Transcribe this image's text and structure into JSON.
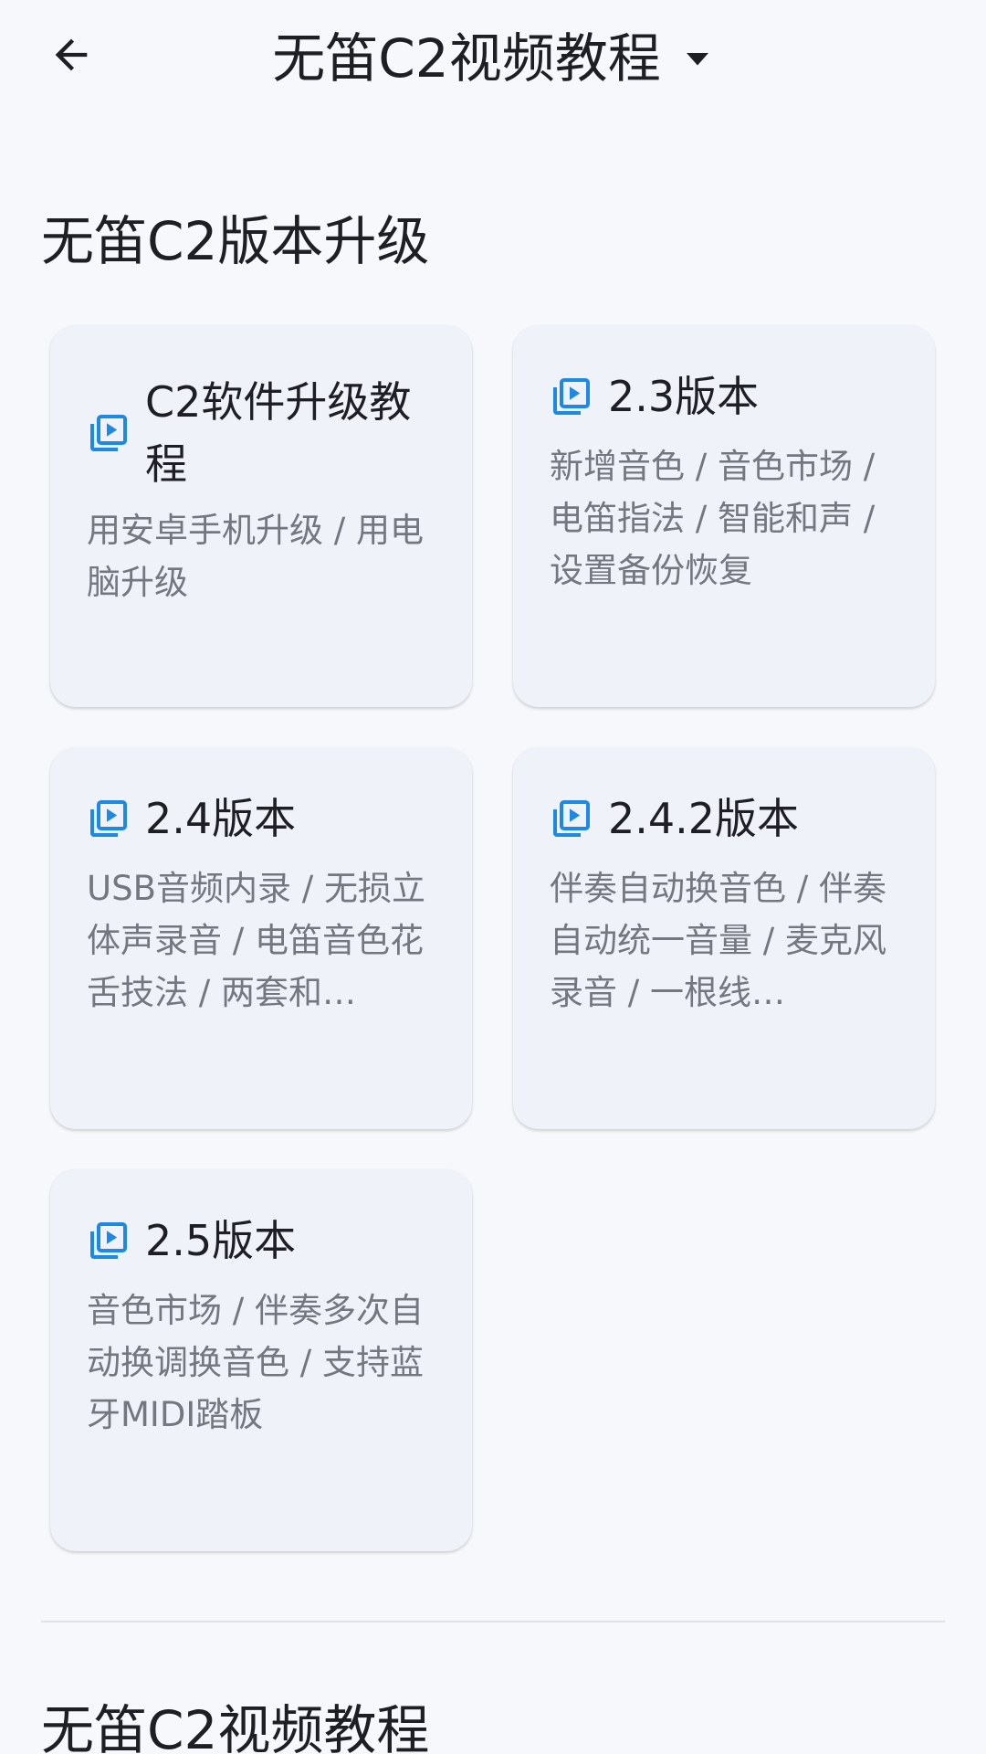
{
  "app_bar": {
    "back_icon": "arrow-back-icon",
    "title": "无笛C2视频教程",
    "dropdown_icon": "arrow-drop-down-icon"
  },
  "sections": [
    {
      "title": "无笛C2版本升级",
      "cards": [
        {
          "icon": "video-library-icon",
          "title": "C2软件升级教程",
          "description": "用安卓手机升级 / 用电脑升级"
        },
        {
          "icon": "video-library-icon",
          "title": "2.3版本",
          "description": "新增音色 / 音色市场 / 电笛指法 / 智能和声 / 设置备份恢复"
        },
        {
          "icon": "video-library-icon",
          "title": "2.4版本",
          "description": "USB音频内录 / 无损立体声录音 / 电笛音色花舌技法 / 两套和…"
        },
        {
          "icon": "video-library-icon",
          "title": "2.4.2版本",
          "description": "伴奏自动换音色 / 伴奏自动统一音量 / 麦克风录音 / 一根线…"
        },
        {
          "icon": "video-library-icon",
          "title": "2.5版本",
          "description": "音色市场 / 伴奏多次自动换调换音色 / 支持蓝牙MIDI踏板"
        }
      ]
    },
    {
      "title": "无笛C2视频教程"
    }
  ],
  "colors": {
    "background": "#f6f8fc",
    "card": "#f0f2fa",
    "accent_icon": "#1e88e5",
    "title_text": "#1d1f24",
    "secondary_text": "#74777f"
  }
}
